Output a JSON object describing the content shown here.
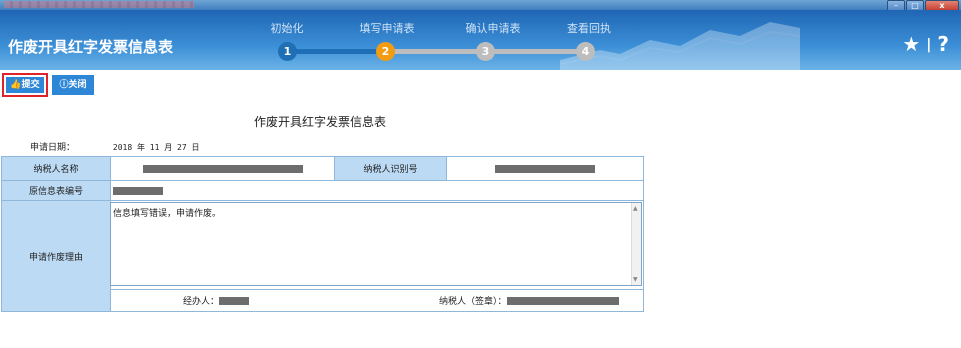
{
  "header": {
    "title": "作废开具红字发票信息表",
    "steps": [
      {
        "label": "初始化",
        "number": "1",
        "state": "done"
      },
      {
        "label": "填写申请表",
        "number": "2",
        "state": "current"
      },
      {
        "label": "确认申请表",
        "number": "3",
        "state": "todo"
      },
      {
        "label": "查看回执",
        "number": "4",
        "state": "todo"
      }
    ],
    "icons": [
      "star-icon",
      "help-icon"
    ],
    "help_glyph": "?",
    "separator": "|"
  },
  "toolbar": {
    "submit_label": "提交",
    "close_label": "关闭"
  },
  "form": {
    "title": "作废开具红字发票信息表",
    "apply_date_label": "申请日期：",
    "apply_date_value": "2018 年 11 月 27 日",
    "taxpayer_name_label": "纳税人名称",
    "taxpayer_id_label": "纳税人识别号",
    "original_no_label": "原信息表编号",
    "reason_label": "申请作废理由",
    "reason_value": "信息填写错误，申请作废。",
    "handler_label": "经办人：",
    "taxpayer_sign_label": "纳税人（签章）："
  },
  "colors": {
    "header_blue": "#1f66b4",
    "done_step": "#1e6fb5",
    "current_step": "#f39c12",
    "todo_step": "#bdbdbd",
    "label_cell": "#bcdaf4",
    "submit_highlight": "#e0222a"
  }
}
